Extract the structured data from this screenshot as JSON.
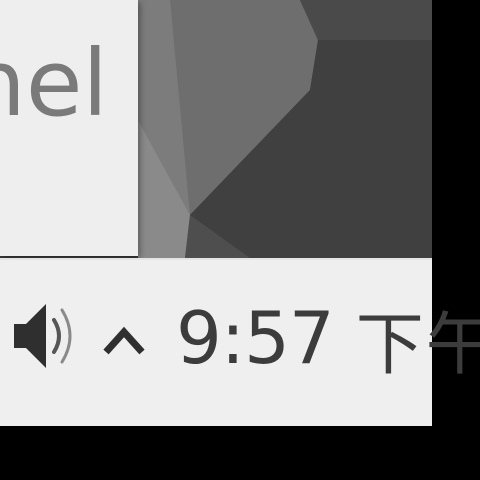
{
  "tooltip": {
    "text": "anel"
  },
  "tray": {
    "volume_icon": "speaker-volume-icon",
    "expander_icon": "chevron-up-icon"
  },
  "clock": {
    "time": "9:57",
    "ampm": "下午"
  },
  "colors": {
    "taskbar_bg": "#efefef",
    "tooltip_bg": "#eeeeee",
    "clock_text": "#3c3c3c",
    "wallpaper_dark": "#3a3a3a",
    "frame": "#000000"
  }
}
